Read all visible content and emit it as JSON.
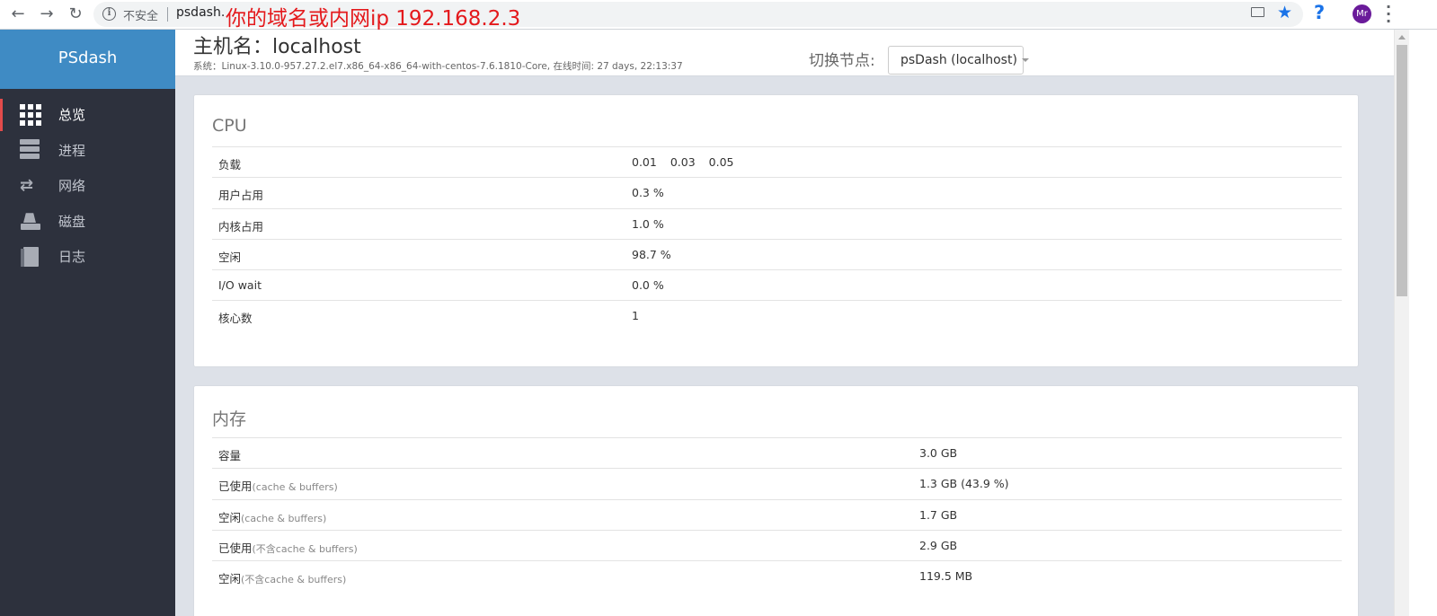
{
  "browser": {
    "insecure_label": "不安全",
    "url_host": "psdash.",
    "annotation": "你的域名或内网ip 192.168.2.3",
    "avatar_initials": "Mr",
    "accent_color": "#1a73e8"
  },
  "sidebar": {
    "brand": "PSdash",
    "items": [
      {
        "label": "总览",
        "icon": "grid-icon",
        "active": true
      },
      {
        "label": "进程",
        "icon": "server-icon"
      },
      {
        "label": "网络",
        "icon": "exchange-arrows-icon"
      },
      {
        "label": "磁盘",
        "icon": "disk-icon"
      },
      {
        "label": "日志",
        "icon": "book-icon"
      }
    ]
  },
  "header": {
    "hostname": "主机名：localhost",
    "system_info": "系统：Linux-3.10.0-957.27.2.el7.x86_64-x86_64-with-centos-7.6.1810-Core, 在线时间: 27 days, 22:13:37",
    "switch_label": "切换节点:",
    "node_selected": "psDash (localhost)"
  },
  "cpu": {
    "title": "CPU",
    "load": [
      "0.01",
      "0.03",
      "0.05"
    ],
    "rows": [
      {
        "label": "负载"
      },
      {
        "label": "用户占用",
        "value": "0.3 %"
      },
      {
        "label": "内核占用",
        "value": "1.0 %"
      },
      {
        "label": "空闲",
        "value": "98.7 %"
      },
      {
        "label": "I/O wait",
        "value": "0.0 %"
      },
      {
        "label": "核心数",
        "value": "1"
      }
    ]
  },
  "memory": {
    "title": "内存",
    "rows": [
      {
        "label": "容量",
        "note": "",
        "value": "3.0 GB"
      },
      {
        "label": "已使用",
        "note": "(cache & buffers)",
        "value": "1.3 GB (43.9 %)"
      },
      {
        "label": "空闲",
        "note": "(cache & buffers)",
        "value": "1.7 GB"
      },
      {
        "label": "已使用",
        "note": "(不含cache & buffers)",
        "value": "2.9 GB"
      },
      {
        "label": "空闲",
        "note": "(不含cache & buffers)",
        "value": "119.5 MB"
      }
    ]
  }
}
